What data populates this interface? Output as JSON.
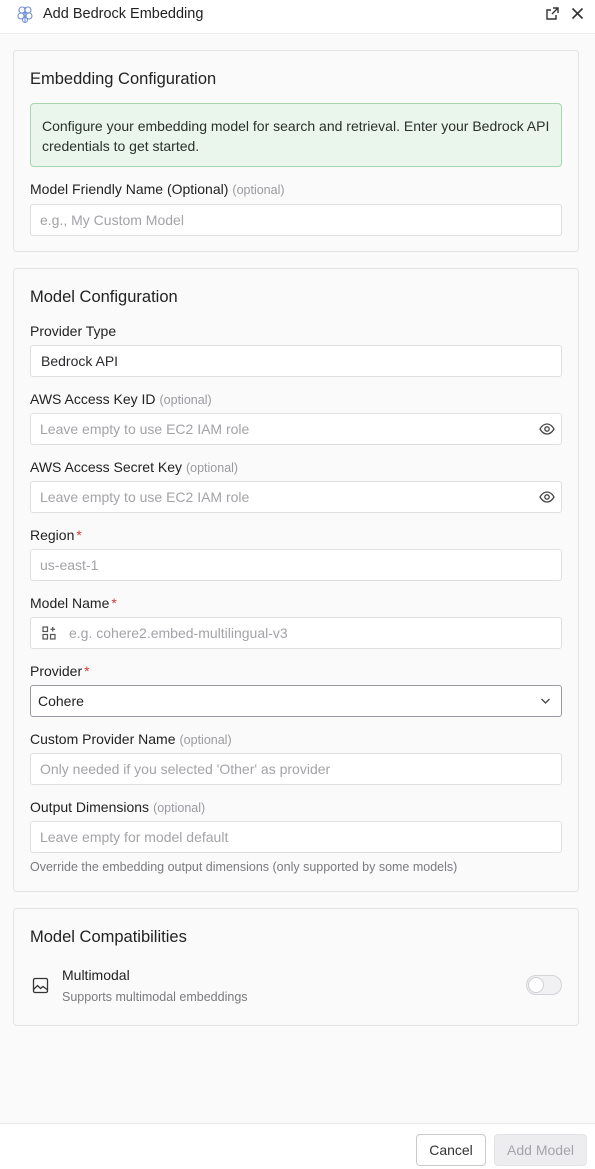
{
  "window": {
    "title": "Add Bedrock Embedding",
    "logo_icon": "brain-circuit-icon",
    "open_external_icon": "open-external-icon",
    "close_icon": "close-icon"
  },
  "embedding_section": {
    "title": "Embedding Configuration",
    "notice": "Configure your embedding model for search and retrieval. Enter your Bedrock API credentials to get started.",
    "friendly_name": {
      "label": "Model Friendly Name (Optional)",
      "optional_tag": "(optional)",
      "placeholder": "e.g., My Custom Model",
      "value": ""
    }
  },
  "model_section": {
    "title": "Model Configuration",
    "provider_type": {
      "label": "Provider Type",
      "value": "Bedrock API"
    },
    "access_key": {
      "label": "AWS Access Key ID",
      "optional_tag": "(optional)",
      "placeholder": "Leave empty to use EC2 IAM role",
      "icon": "eye-icon"
    },
    "secret_key": {
      "label": "AWS Access Secret Key",
      "optional_tag": "(optional)",
      "placeholder": "Leave empty to use EC2 IAM role",
      "icon": "eye-icon"
    },
    "region": {
      "label": "Region",
      "required_mark": "*",
      "placeholder": "us-east-1"
    },
    "model_name": {
      "label": "Model Name",
      "required_mark": "*",
      "placeholder": "e.g. cohere2.embed-multilingual-v3",
      "icon": "model-grid-icon"
    },
    "provider": {
      "label": "Provider",
      "required_mark": "*",
      "selected": "Cohere",
      "icon": "chevron-down-icon"
    },
    "custom_provider": {
      "label": "Custom Provider Name",
      "optional_tag": "(optional)",
      "placeholder": "Only needed if you selected 'Other' as provider"
    },
    "output_dimensions": {
      "label": "Output Dimensions",
      "optional_tag": "(optional)",
      "placeholder": "Leave empty for model default",
      "hint": "Override the embedding output dimensions (only supported by some models)"
    }
  },
  "compat_section": {
    "title": "Model Compatibilities",
    "multimodal": {
      "label": "Multimodal",
      "description": "Supports multimodal embeddings",
      "icon": "image-icon",
      "enabled": false
    }
  },
  "footer": {
    "cancel_label": "Cancel",
    "add_label": "Add Model"
  },
  "colors": {
    "required": "#d33a3a",
    "notice_bg": "#eaf6ec",
    "notice_border": "#a7d6b1"
  }
}
